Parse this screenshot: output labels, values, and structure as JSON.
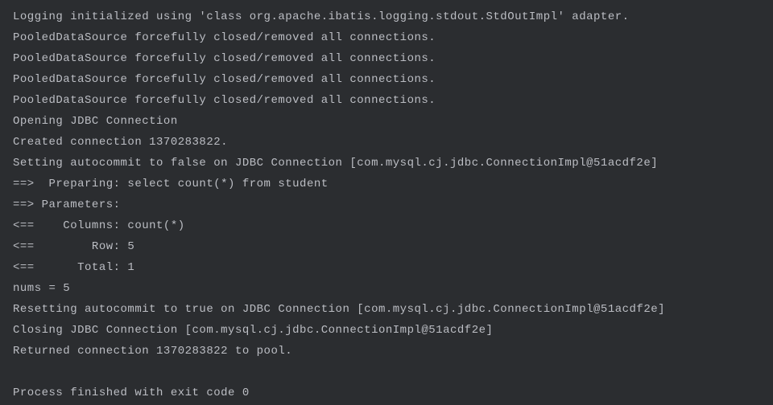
{
  "console": {
    "lines": [
      "Logging initialized using 'class org.apache.ibatis.logging.stdout.StdOutImpl' adapter.",
      "PooledDataSource forcefully closed/removed all connections.",
      "PooledDataSource forcefully closed/removed all connections.",
      "PooledDataSource forcefully closed/removed all connections.",
      "PooledDataSource forcefully closed/removed all connections.",
      "Opening JDBC Connection",
      "Created connection 1370283822.",
      "Setting autocommit to false on JDBC Connection [com.mysql.cj.jdbc.ConnectionImpl@51acdf2e]",
      "==>  Preparing: select count(*) from student",
      "==> Parameters:",
      "<==    Columns: count(*)",
      "<==        Row: 5",
      "<==      Total: 1",
      "nums = 5",
      "Resetting autocommit to true on JDBC Connection [com.mysql.cj.jdbc.ConnectionImpl@51acdf2e]",
      "Closing JDBC Connection [com.mysql.cj.jdbc.ConnectionImpl@51acdf2e]",
      "Returned connection 1370283822 to pool.",
      "",
      "Process finished with exit code 0"
    ]
  }
}
